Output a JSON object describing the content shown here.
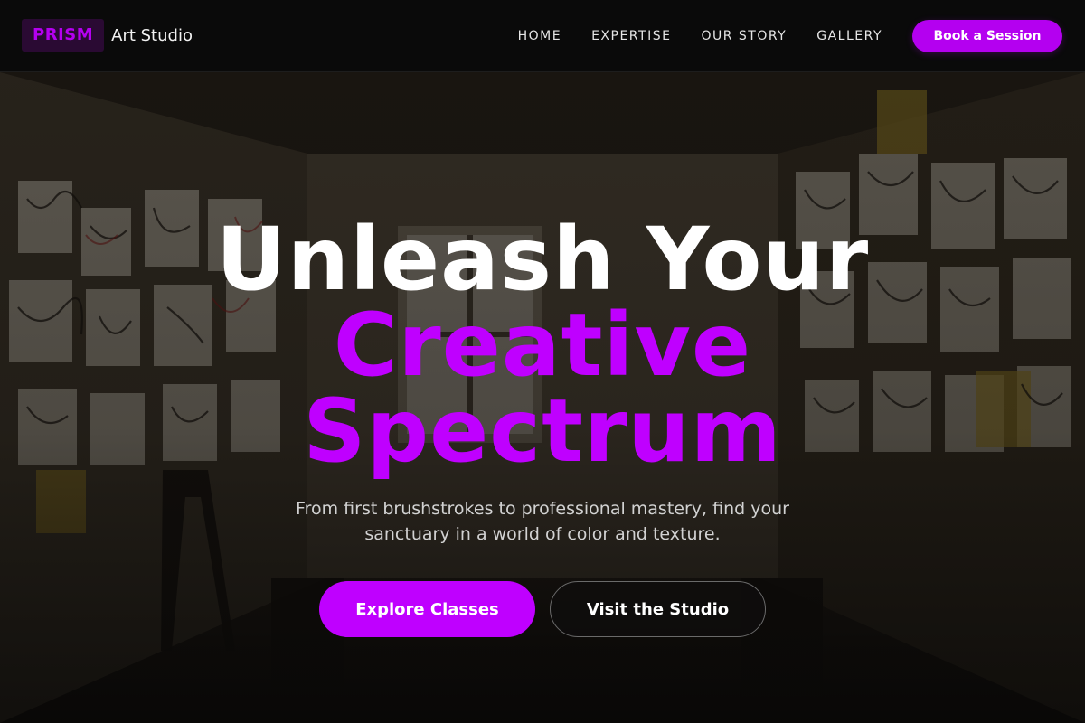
{
  "nav": {
    "brand_mark": "PRISM",
    "brand_name": "Art Studio",
    "links": [
      "HOME",
      "EXPERTISE",
      "OUR STORY",
      "GALLERY"
    ],
    "cta_label": "Book a Session"
  },
  "hero": {
    "headline_line1": "Unleash Your",
    "headline_line2": "Creative",
    "headline_line3": "Spectrum",
    "subtitle": "From first brushstrokes to professional mastery, find your sanctuary in a world of color and texture.",
    "primary_button": "Explore Classes",
    "secondary_button": "Visit the Studio",
    "background_image": "dimly lit art studio room with walls covered in drawings"
  },
  "colors": {
    "accent": "#bf00ff",
    "nav_background": "#0a0a0a",
    "text_primary": "#ffffff",
    "text_secondary": "#d2d2d2"
  }
}
